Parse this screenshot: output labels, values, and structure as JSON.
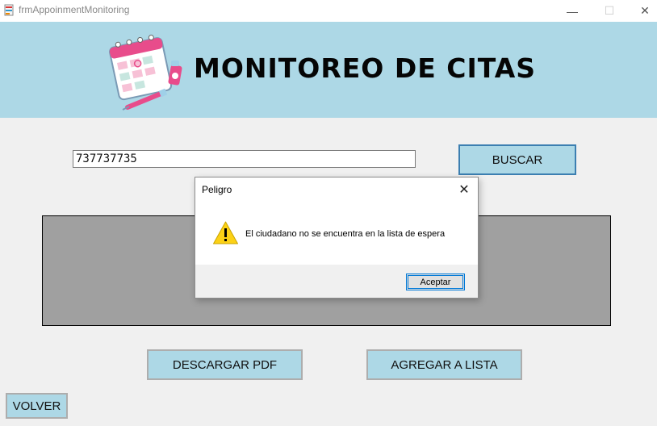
{
  "window": {
    "title": "frmAppoinmentMonitoring",
    "minimize": "—",
    "maximize": "☐",
    "close": "✕"
  },
  "header": {
    "title": "MONITOREO DE CITAS",
    "background": "#add8e6"
  },
  "search": {
    "value": "737737735",
    "button_label": "BUSCAR"
  },
  "actions": {
    "download_pdf": "DESCARGAR PDF",
    "add_to_list": "AGREGAR A LISTA",
    "back": "VOLVER"
  },
  "dialog": {
    "title": "Peligro",
    "close": "✕",
    "icon": "warning-icon",
    "message": "El ciudadano no se encuentra en la lista de espera",
    "ok_label": "Aceptar"
  },
  "colors": {
    "button_fill": "#add8e6",
    "results_panel": "#a0a0a0",
    "focus_border": "#3c7fb1"
  }
}
